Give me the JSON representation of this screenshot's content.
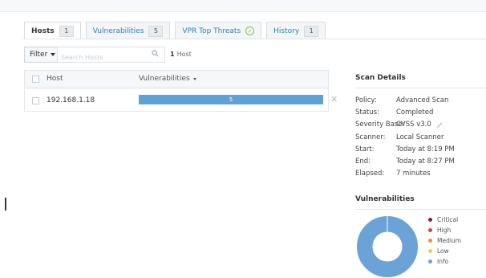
{
  "tabs": [
    {
      "label": "Hosts",
      "count": "1"
    },
    {
      "label": "Vulnerabilities",
      "count": "5"
    },
    {
      "label": "VPR Top Threats"
    },
    {
      "label": "History",
      "count": "1"
    }
  ],
  "filter": {
    "label": "Filter",
    "search_placeholder": "Search Hosts",
    "count_number": "1",
    "count_text": "Host"
  },
  "table": {
    "columns": {
      "host": "Host",
      "vulnerabilities": "Vulnerabilities"
    },
    "rows": [
      {
        "host": "192.168.1.18",
        "vuln_count": "5",
        "bar_fill": 1.0
      }
    ]
  },
  "scan_details": {
    "title": "Scan Details",
    "rows": [
      {
        "label": "Policy:",
        "value": "Advanced Scan"
      },
      {
        "label": "Status:",
        "value": "Completed"
      },
      {
        "label": "Severity Base:",
        "value": "CVSS v3.0"
      },
      {
        "label": "Scanner:",
        "value": "Local Scanner"
      },
      {
        "label": "Start:",
        "value": "Today at 8:19 PM"
      },
      {
        "label": "End:",
        "value": "Today at 8:27 PM"
      },
      {
        "label": "Elapsed:",
        "value": "7 minutes"
      }
    ]
  },
  "vulnerabilities_panel": {
    "title": "Vulnerabilities",
    "legend": [
      {
        "label": "Critical",
        "color": "#8e1b3a"
      },
      {
        "label": "High",
        "color": "#d9433a"
      },
      {
        "label": "Medium",
        "color": "#ee8f4a"
      },
      {
        "label": "Low",
        "color": "#f2c94c"
      },
      {
        "label": "Info",
        "color": "#6ba3d6"
      }
    ]
  },
  "chart_data": {
    "type": "pie",
    "categories": [
      "Critical",
      "High",
      "Medium",
      "Low",
      "Info"
    ],
    "values": [
      0,
      0,
      0,
      0,
      5
    ],
    "colors": [
      "#8e1b3a",
      "#d9433a",
      "#ee8f4a",
      "#f2c94c",
      "#6ba3d6"
    ],
    "donut": true
  }
}
